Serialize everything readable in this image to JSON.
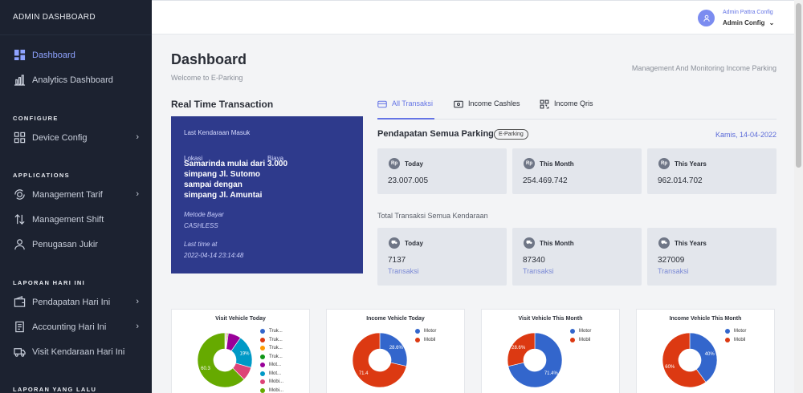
{
  "sidebar": {
    "brand": "ADMIN DASHBOARD",
    "items_main": [
      {
        "label": "Dashboard",
        "icon": "dashboard-icon"
      },
      {
        "label": "Analytics Dashboard",
        "icon": "bar-chart-icon"
      }
    ],
    "section_configure": "CONFIGURE",
    "device_config": "Device Config",
    "section_applications": "APPLICATIONS",
    "management_tarif": "Management Tarif",
    "management_shift": "Management Shift",
    "penugasan_jukir": "Penugasan Jukir",
    "section_laporan_hari_ini": "LAPORAN HARI INI",
    "pendapatan_hari_ini": "Pendapatan Hari Ini",
    "accounting_hari_ini": "Accounting Hari Ini",
    "visit_kendaraan_hari_ini": "Visit Kendaraan Hari Ini",
    "section_laporan_yang_lalu": "LAPORAN YANG LALU"
  },
  "topbar": {
    "user_name": "Admin Pattra Config",
    "user_role": "Admin Config",
    "chevron": "⌄"
  },
  "header": {
    "title": "Dashboard",
    "subtitle": "Welcome to E-Parking",
    "right_text": "Management And Monitoring Income Parking"
  },
  "realtime": {
    "title": "Real Time Transaction",
    "last_vehicle": "Last Kendaraan Masuk",
    "lokasi_label": "Lokasi",
    "biaya_label": "Biaya",
    "lokasi_value": "Samarinda mulai dari simpang Jl. Sutomo sampai dengan simpang Jl. Amuntai",
    "biaya_value": "3.000",
    "metode_label": "Metode Bayar",
    "metode_value": "CASHLESS",
    "last_time_label": "Last time at",
    "last_time_value": "2022-04-14 23:14:48"
  },
  "tabs": [
    {
      "label": "All Transaksi",
      "icon": "card-icon"
    },
    {
      "label": "Income Cashles",
      "icon": "cash-icon"
    },
    {
      "label": "Income Qris",
      "icon": "qr-icon"
    }
  ],
  "pendapatan": {
    "title": "Pendapatan Semua Parking",
    "badge": "E-Parking",
    "date": "Kamis, 14-04-2022",
    "icon_text": "Rp",
    "cards": [
      {
        "label": "Today",
        "value": "23.007.005"
      },
      {
        "label": "This Month",
        "value": "254.469.742"
      },
      {
        "label": "This Years",
        "value": "962.014.702"
      }
    ]
  },
  "transaksi": {
    "title": "Total Transaksi Semua Kendaraan",
    "unit": "Transaksi",
    "cards": [
      {
        "label": "Today",
        "value": "7137"
      },
      {
        "label": "This Month",
        "value": "87340"
      },
      {
        "label": "This Years",
        "value": "327009"
      }
    ]
  },
  "charts": [
    {
      "title": "Visit Vehicle Today",
      "legend": [
        "Truk...",
        "Truk...",
        "Truk...",
        "Truk...",
        "Mot...",
        "Mot...",
        "Mobi...",
        "Mobi..."
      ],
      "colors": [
        "#3366cc",
        "#dc3912",
        "#ff9900",
        "#109618",
        "#990099",
        "#0099c6",
        "#dd4477",
        "#66aa00"
      ],
      "values": [
        0.5,
        0.5,
        0.5,
        0.5,
        7.4,
        19,
        7.9,
        60.3
      ],
      "labels": [
        "",
        "",
        "",
        "",
        "",
        "19%",
        "",
        "60.3"
      ]
    },
    {
      "title": "Income Vehicle Today",
      "legend": [
        "Motor",
        "Mobil"
      ],
      "colors": [
        "#3366cc",
        "#dc3912"
      ],
      "values": [
        28.6,
        71.4
      ],
      "labels": [
        "28.6%",
        "71.4"
      ]
    },
    {
      "title": "Visit Vehicle This Month",
      "legend": [
        "Motor",
        "Mobil"
      ],
      "colors": [
        "#3366cc",
        "#dc3912"
      ],
      "values": [
        71.4,
        28.6
      ],
      "labels": [
        "71.4%",
        "28.6%"
      ]
    },
    {
      "title": "Income Vehicle This Month",
      "legend": [
        "Motor",
        "Mobil"
      ],
      "colors": [
        "#3366cc",
        "#dc3912"
      ],
      "values": [
        40,
        60
      ],
      "labels": [
        "40%",
        "60%"
      ]
    }
  ],
  "chart_data": [
    {
      "type": "pie",
      "title": "Visit Vehicle Today",
      "categories": [
        "Truk...",
        "Truk...",
        "Truk...",
        "Truk...",
        "Mot...",
        "Mot...",
        "Mobi...",
        "Mobi..."
      ],
      "values": [
        0.5,
        0.5,
        0.5,
        0.5,
        7.4,
        19,
        7.9,
        60.3
      ]
    },
    {
      "type": "pie",
      "title": "Income Vehicle Today",
      "categories": [
        "Motor",
        "Mobil"
      ],
      "values": [
        28.6,
        71.4
      ]
    },
    {
      "type": "pie",
      "title": "Visit Vehicle This Month",
      "categories": [
        "Motor",
        "Mobil"
      ],
      "values": [
        71.4,
        28.6
      ]
    },
    {
      "type": "pie",
      "title": "Income Vehicle This Month",
      "categories": [
        "Motor",
        "Mobil"
      ],
      "values": [
        40,
        60
      ]
    }
  ]
}
